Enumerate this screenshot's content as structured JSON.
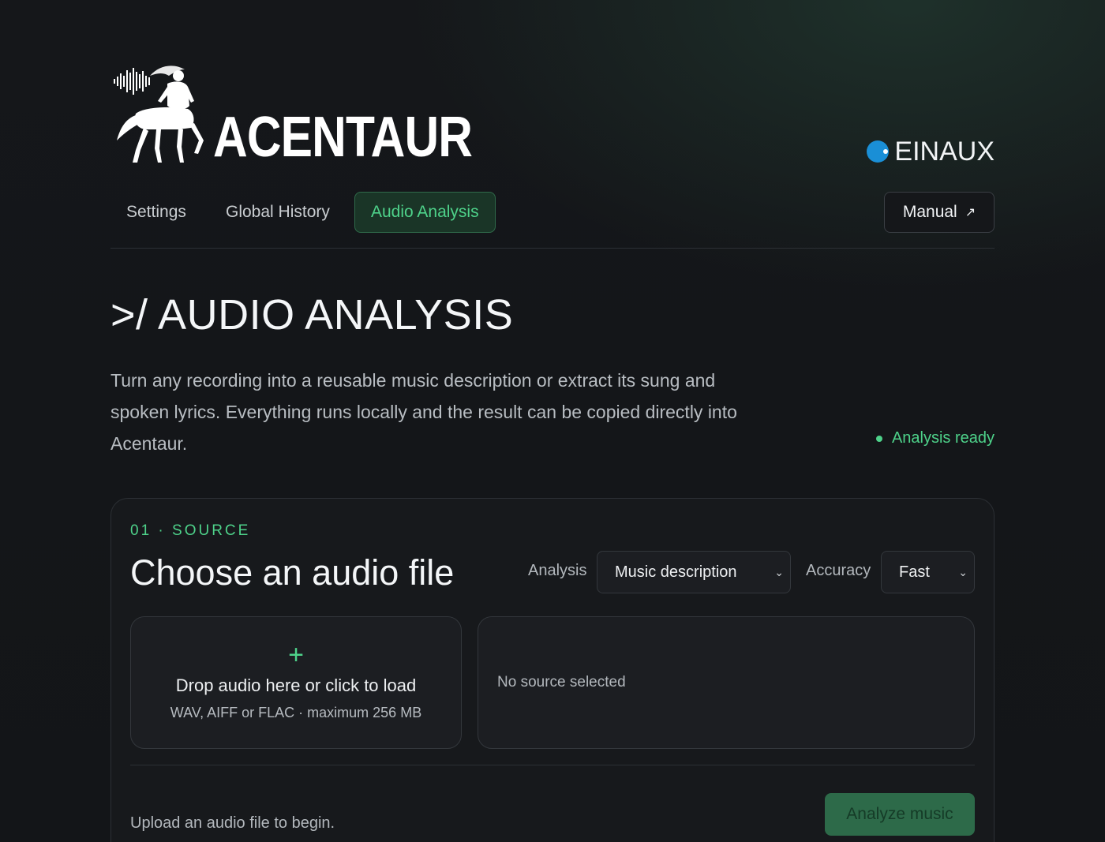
{
  "header": {
    "brand_name": "ACENTAUR",
    "partner_name": "EINAUX"
  },
  "nav": {
    "tabs": [
      {
        "label": "Settings",
        "active": false
      },
      {
        "label": "Global History",
        "active": false
      },
      {
        "label": "Audio Analysis",
        "active": true
      }
    ],
    "manual_label": "Manual",
    "manual_icon": "external-arrow-icon"
  },
  "main": {
    "title": ">/ AUDIO ANALYSIS",
    "intro": "Turn any recording into a reusable music description or extract its sung and spoken lyrics. Everything runs locally and the result can be copied directly into Acentaur.",
    "status": "Analysis ready"
  },
  "source_card": {
    "step_label": "01 · SOURCE",
    "title": "Choose an audio file",
    "analysis_label": "Analysis",
    "analysis_value": "Music description",
    "accuracy_label": "Accuracy",
    "accuracy_value": "Fast",
    "drop_icon": "+",
    "drop_main": "Drop audio here or click to load",
    "drop_sub": "WAV, AIFF or FLAC · maximum 256 MB",
    "preview_text": "No source selected",
    "hint": "Upload an audio file to begin.",
    "analyze_button": "Analyze music"
  },
  "colors": {
    "accent": "#4ed28a",
    "background": "#131518",
    "card": "#17191c",
    "partner_dot": "#1a8fd6"
  }
}
